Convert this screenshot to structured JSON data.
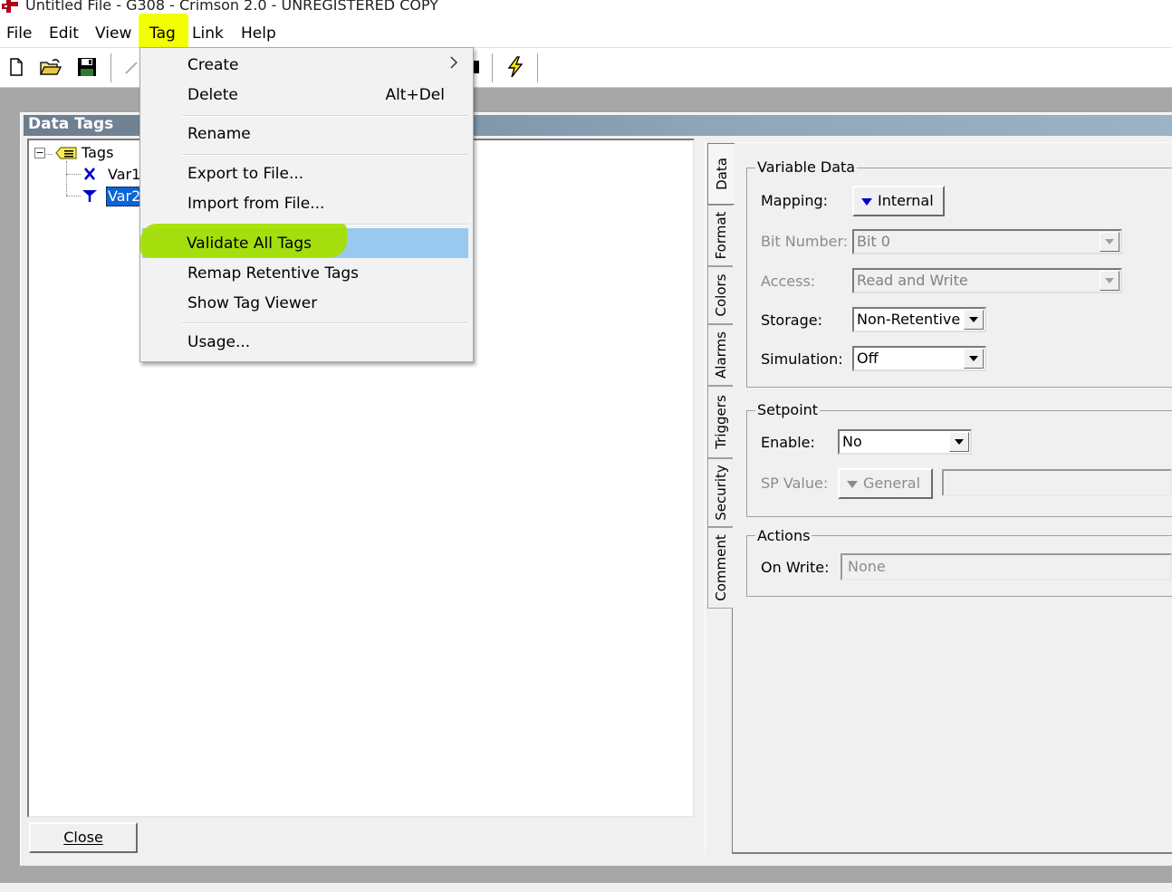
{
  "window": {
    "title": "Untitled File - G308 - Crimson 2.0 - UNREGISTERED COPY"
  },
  "menubar": {
    "items": [
      {
        "label": "File"
      },
      {
        "label": "Edit"
      },
      {
        "label": "View"
      },
      {
        "label": "Tag"
      },
      {
        "label": "Link"
      },
      {
        "label": "Help"
      }
    ]
  },
  "toolbar": {
    "icons": [
      "new-file-icon",
      "open-folder-icon",
      "save-disk-icon",
      "pen-icon",
      "lightning-icon"
    ]
  },
  "tag_menu": {
    "items": [
      {
        "label": "Create",
        "shortcut": "",
        "submenu": true
      },
      {
        "label": "Delete",
        "shortcut": "Alt+Del"
      },
      {
        "label": "Rename"
      },
      {
        "label": "Export to File..."
      },
      {
        "label": "Import from File..."
      },
      {
        "label": "Validate All Tags",
        "highlighted": true
      },
      {
        "label": "Remap Retentive Tags"
      },
      {
        "label": "Show Tag Viewer"
      },
      {
        "label": "Usage..."
      }
    ]
  },
  "dialog": {
    "caption": "Data Tags",
    "close_label": "Close",
    "tree": {
      "root": "Tags",
      "children": [
        {
          "label": "Var1",
          "icon": "integer-tag-icon"
        },
        {
          "label": "Var2",
          "icon": "flag-tag-icon",
          "selected": true
        }
      ]
    }
  },
  "tabs": [
    "Data",
    "Format",
    "Colors",
    "Alarms",
    "Triggers",
    "Security",
    "Comment"
  ],
  "variable_data": {
    "title": "Variable Data",
    "mapping_label": "Mapping:",
    "mapping_value": "Internal",
    "bit_number_label": "Bit Number:",
    "bit_number_value": "Bit 0",
    "access_label": "Access:",
    "access_value": "Read and Write",
    "storage_label": "Storage:",
    "storage_value": "Non-Retentive",
    "simulation_label": "Simulation:",
    "simulation_value": "Off"
  },
  "setpoint": {
    "title": "Setpoint",
    "enable_label": "Enable:",
    "enable_value": "No",
    "sp_value_label": "SP Value:",
    "sp_value_button": "General",
    "sp_value_field": ""
  },
  "actions": {
    "title": "Actions",
    "on_write_label": "On Write:",
    "on_write_value": "None"
  },
  "colors": {
    "highlight_yellow": "#f2ff00",
    "highlight_green": "#a4e000",
    "menu_selection": "#99c9ef",
    "tree_selection": "#0a64d8"
  }
}
